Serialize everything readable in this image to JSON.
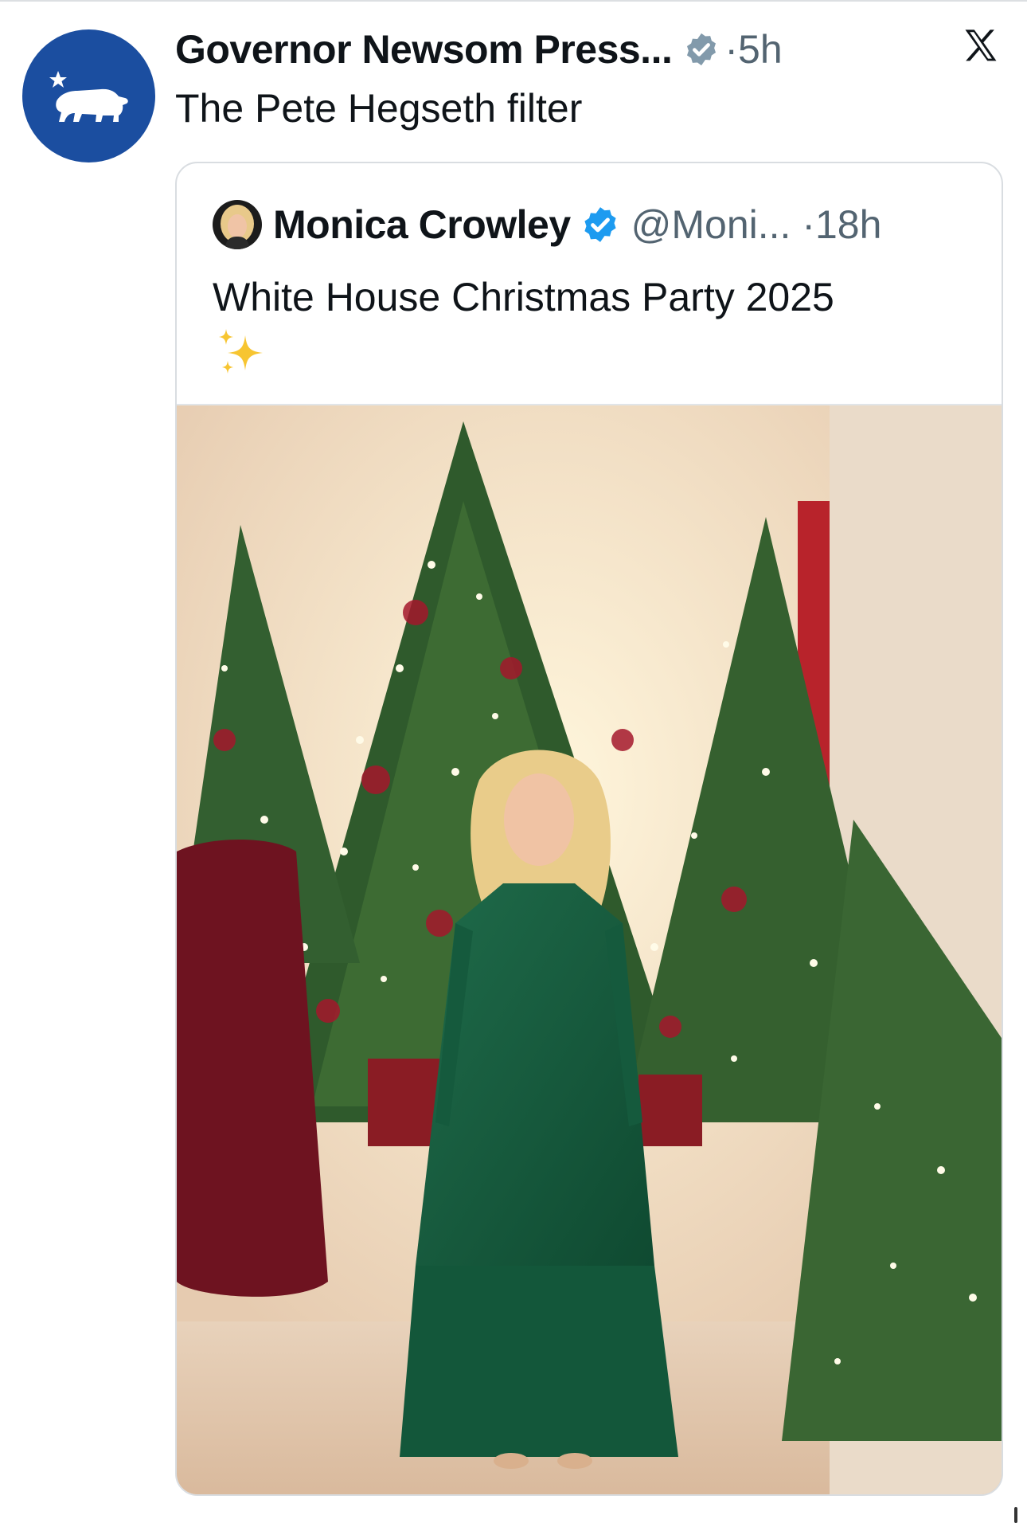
{
  "post": {
    "author_name": "Governor Newsom Press...",
    "time": "·5h",
    "text": "The Pete Hegseth filter",
    "avatar_icon": "california-bear-star-icon",
    "avatar_color": "#1b4ea0",
    "badge_icon": "verified-gray-badge-icon",
    "badge_color": "#829aab"
  },
  "app": {
    "logo_icon": "x-logo-icon"
  },
  "quoted": {
    "author_name": "Monica Crowley",
    "handle_time": "@Moni... ·18h",
    "text": "White House Christmas Party 2025",
    "emoji": "✨",
    "badge_icon": "verified-blue-badge-icon",
    "badge_color": "#1d9bf0",
    "photo_icon": "christmas-tree-photo"
  }
}
